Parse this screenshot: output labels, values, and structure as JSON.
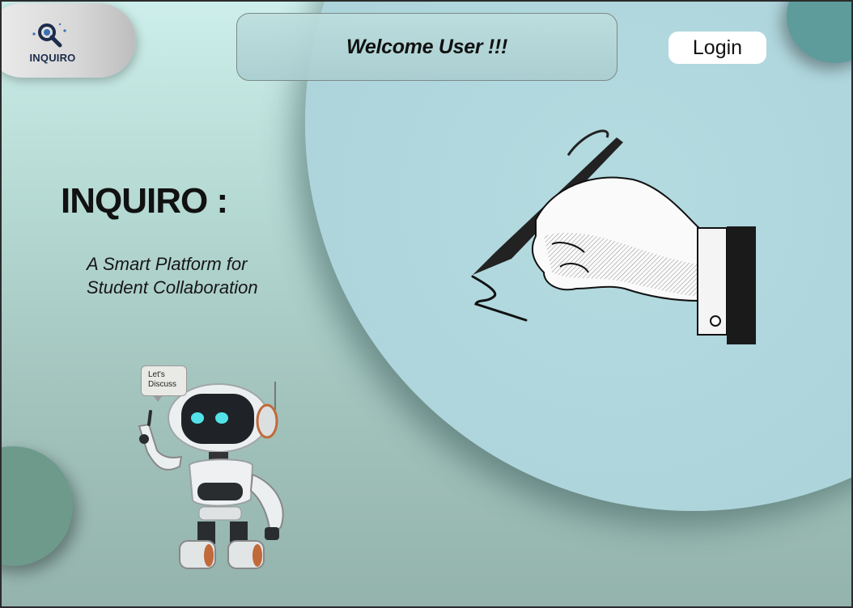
{
  "brand": {
    "logo_text": "INQUIRO"
  },
  "header": {
    "welcome": "Welcome User !!!",
    "login_label": "Login"
  },
  "hero": {
    "title": "INQUIRO :",
    "subtitle_line1": "A Smart Platform for",
    "subtitle_line2": "Student Collaboration"
  },
  "robot": {
    "bubble_line1": "Let's",
    "bubble_line2": "Discuss"
  },
  "colors": {
    "page_bg": "#bfe3df",
    "circle": "#acd3da",
    "blob_tr": "#5e9c9c",
    "blob_bl": "#6e9a8c",
    "logo_text": "#1c2c4c"
  },
  "icons": [
    "search-magnifier-logo-icon",
    "pen-hand-illustration",
    "robot-illustration"
  ]
}
